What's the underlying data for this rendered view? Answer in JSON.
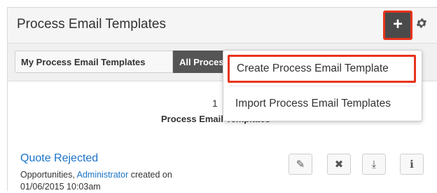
{
  "dashlet": {
    "title": "Process Email Templates",
    "add_label": "+",
    "settings_icon": "gear-icon"
  },
  "tabs": {
    "mine": "My Process Email Templates",
    "all": "All Process Email Templates"
  },
  "dropdown": {
    "create": "Create Process Email Template",
    "import": "Import Process Email Templates"
  },
  "list": {
    "count": "1",
    "heading": "Process Email Templates"
  },
  "record": {
    "title": "Quote Rejected",
    "module": "Opportunities,",
    "user": "Administrator",
    "created_label": "created on",
    "date": "01/06/2015 10:03am"
  },
  "colors": {
    "accent_link": "#1a73c8",
    "highlight_border": "#e8331c",
    "dark_button": "#4a4a4a"
  }
}
